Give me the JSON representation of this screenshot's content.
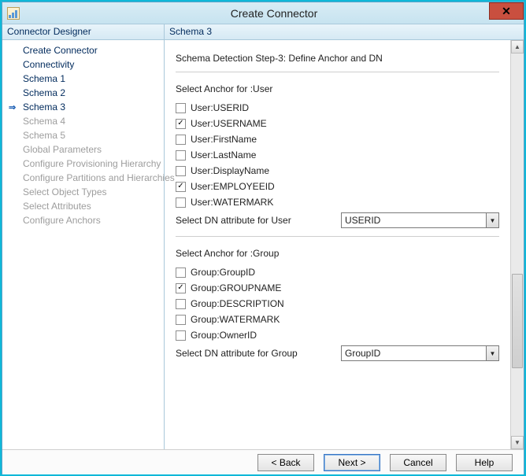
{
  "window": {
    "title": "Create Connector"
  },
  "sidebar": {
    "header": "Connector Designer",
    "items": [
      {
        "label": "Create Connector",
        "state": "done"
      },
      {
        "label": "Connectivity",
        "state": "done"
      },
      {
        "label": "Schema 1",
        "state": "done"
      },
      {
        "label": "Schema 2",
        "state": "done"
      },
      {
        "label": "Schema 3",
        "state": "current"
      },
      {
        "label": "Schema 4",
        "state": "pending"
      },
      {
        "label": "Schema 5",
        "state": "pending"
      },
      {
        "label": "Global Parameters",
        "state": "pending"
      },
      {
        "label": "Configure Provisioning Hierarchy",
        "state": "pending"
      },
      {
        "label": "Configure Partitions and Hierarchies",
        "state": "pending"
      },
      {
        "label": "Select Object Types",
        "state": "pending"
      },
      {
        "label": "Select Attributes",
        "state": "pending"
      },
      {
        "label": "Configure Anchors",
        "state": "pending"
      }
    ]
  },
  "main": {
    "header": "Schema 3",
    "step_title": "Schema Detection Step-3: Define Anchor and DN",
    "user_section": {
      "label": "Select Anchor for :User",
      "checks": [
        {
          "label": "User:USERID",
          "checked": false
        },
        {
          "label": "User:USERNAME",
          "checked": true
        },
        {
          "label": "User:FirstName",
          "checked": false
        },
        {
          "label": "User:LastName",
          "checked": false
        },
        {
          "label": "User:DisplayName",
          "checked": false
        },
        {
          "label": "User:EMPLOYEEID",
          "checked": true
        },
        {
          "label": "User:WATERMARK",
          "checked": false
        }
      ],
      "dn_label": "Select DN attribute for User",
      "dn_value": "USERID"
    },
    "group_section": {
      "label": "Select Anchor for :Group",
      "checks": [
        {
          "label": "Group:GroupID",
          "checked": false
        },
        {
          "label": "Group:GROUPNAME",
          "checked": true
        },
        {
          "label": "Group:DESCRIPTION",
          "checked": false
        },
        {
          "label": "Group:WATERMARK",
          "checked": false
        },
        {
          "label": "Group:OwnerID",
          "checked": false
        }
      ],
      "dn_label": "Select DN attribute for Group",
      "dn_value": "GroupID"
    }
  },
  "footer": {
    "back": "<  Back",
    "next": "Next  >",
    "cancel": "Cancel",
    "help": "Help"
  }
}
